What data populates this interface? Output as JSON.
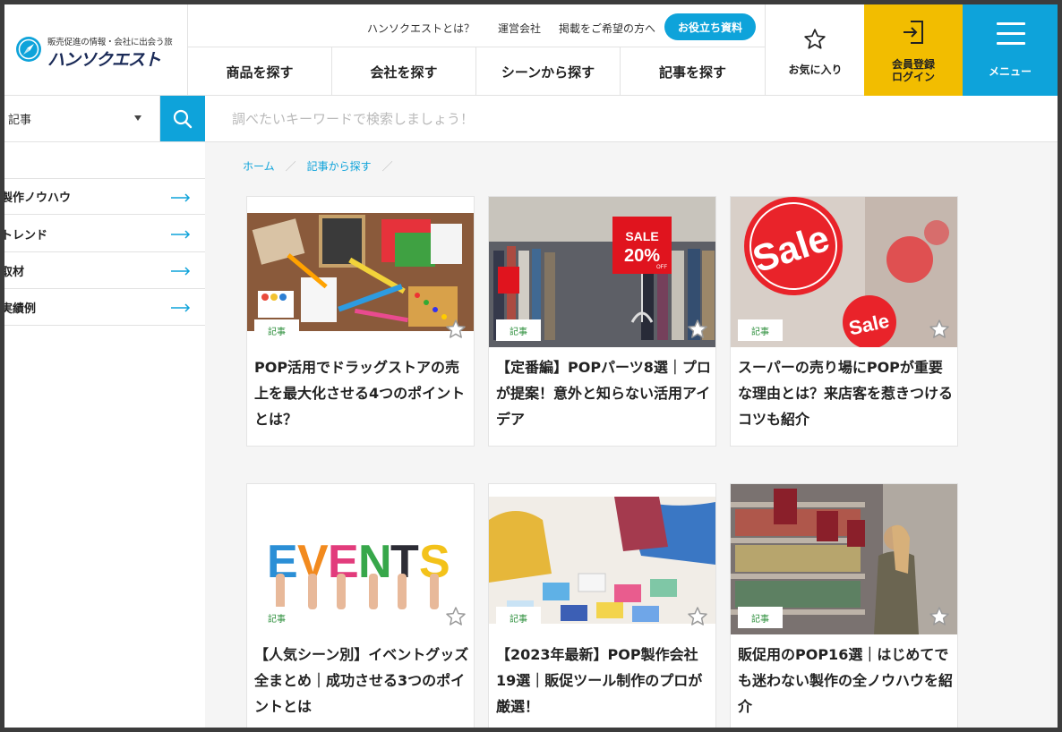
{
  "header": {
    "tagline": "販売促進の情報・会社に出会う旅",
    "brand": "ハンソクエスト",
    "top_links": [
      "ハンソクエストとは？",
      "運営会社",
      "掲載をご希望の方へ"
    ],
    "resource_button": "お役立ち資料",
    "nav": [
      "商品を探す",
      "会社を探す",
      "シーンから探す",
      "記事を探す"
    ],
    "favorites": "お気に入り",
    "login_line1": "会員登録",
    "login_line2": "ログイン",
    "menu": "メニュー",
    "colors": {
      "accent": "#0ea3da",
      "login_bg": "#f2bd00",
      "brand_text": "#1a2a57"
    }
  },
  "search": {
    "category": "記事",
    "placeholder": "調べたいキーワードで検索しましょう！"
  },
  "sidebar": {
    "items": [
      "製作ノウハウ",
      "トレンド",
      "取材",
      "実績例"
    ]
  },
  "breadcrumb": {
    "items": [
      "ホーム",
      "記事から探す"
    ]
  },
  "cards": [
    {
      "tag": "記事",
      "title": "POP活用でドラッグストアの売上を最大化させる4つのポイントとは？",
      "image": "stationery-desk"
    },
    {
      "tag": "記事",
      "title": "【定番編】POPパーツ8選｜プロが提案！意外と知らない活用アイデア",
      "image": "sale-20-off-store"
    },
    {
      "tag": "記事",
      "title": "スーパーの売り場にPOPが重要な理由とは？来店客を惹きつけるコツも紹介",
      "image": "sale-signs"
    },
    {
      "tag": "記事",
      "title": "【人気シーン別】イベントグッズ全まとめ｜成功させる3つのポイントとは",
      "image": "events-letters",
      "image_text": "EVENTS"
    },
    {
      "tag": "記事",
      "title": "【2023年最新】POP製作会社19選｜販促ツール制作のプロが厳選！",
      "image": "design-meeting"
    },
    {
      "tag": "記事",
      "title": "販促用のPOP16選｜はじめてでも迷わない製作の全ノウハウを紹介",
      "image": "supermarket-shopper"
    }
  ],
  "image_texts": {
    "sale20_top": "SALE",
    "sale20_num": "20%",
    "sale20_off": "OFF",
    "sale_small": "SALE",
    "sale_big": "Sale"
  }
}
